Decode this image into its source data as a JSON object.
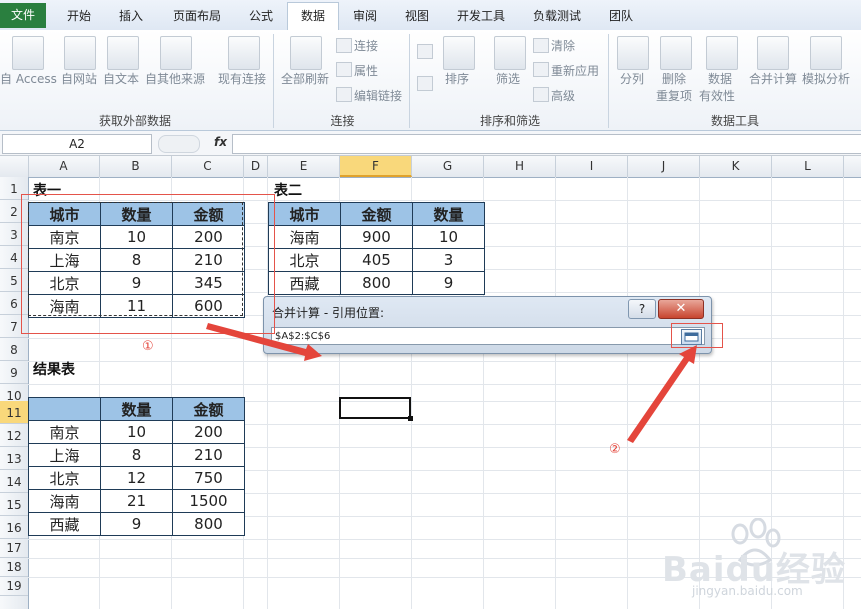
{
  "tabs": [
    "文件",
    "开始",
    "插入",
    "页面布局",
    "公式",
    "数据",
    "审阅",
    "视图",
    "开发工具",
    "负载测试",
    "团队"
  ],
  "ribbon": {
    "get_external": {
      "title": "获取外部数据",
      "buttons": [
        "自 Access",
        "自网站",
        "自文本",
        "自其他来源",
        "现有连接"
      ]
    },
    "connections": {
      "title": "连接",
      "refresh_all": "全部刷新",
      "small": [
        "连接",
        "属性",
        "编辑链接"
      ]
    },
    "sort_filter": {
      "title": "排序和筛选",
      "sort": "排序",
      "filter": "筛选",
      "small": [
        "清除",
        "重新应用",
        "高级"
      ]
    },
    "data_tools": {
      "title": "数据工具",
      "split": "分列",
      "remove_dup": [
        "删除",
        "重复项"
      ],
      "validation": [
        "数据",
        "有效性"
      ],
      "consolidate": "合并计算",
      "whatif": "模拟分析"
    }
  },
  "formula_bar": {
    "name_box": "A2",
    "fx": "fx",
    "content": ""
  },
  "columns": [
    "A",
    "B",
    "C",
    "D",
    "E",
    "F",
    "G",
    "H",
    "I",
    "J",
    "K",
    "L"
  ],
  "rows": [
    "1",
    "2",
    "3",
    "4",
    "5",
    "6",
    "7",
    "8",
    "9",
    "10",
    "11",
    "12",
    "13",
    "14",
    "15",
    "16",
    "17",
    "18",
    "19"
  ],
  "table1": {
    "title": "表一",
    "headers": [
      "城市",
      "数量",
      "金额"
    ],
    "rows": [
      [
        "南京",
        "10",
        "200"
      ],
      [
        "上海",
        "8",
        "210"
      ],
      [
        "北京",
        "9",
        "345"
      ],
      [
        "海南",
        "11",
        "600"
      ]
    ]
  },
  "table2": {
    "title": "表二",
    "headers": [
      "城市",
      "金额",
      "数量"
    ],
    "rows": [
      [
        "海南",
        "900",
        "10"
      ],
      [
        "北京",
        "405",
        "3"
      ],
      [
        "西藏",
        "800",
        "9"
      ]
    ]
  },
  "result": {
    "title": "结果表",
    "headers": [
      "",
      "数量",
      "金额"
    ],
    "rows": [
      [
        "南京",
        "10",
        "200"
      ],
      [
        "上海",
        "8",
        "210"
      ],
      [
        "北京",
        "12",
        "750"
      ],
      [
        "海南",
        "21",
        "1500"
      ],
      [
        "西藏",
        "9",
        "800"
      ]
    ]
  },
  "dialog": {
    "title": "合并计算 - 引用位置:",
    "help": "?",
    "close": "✕",
    "reference": "$A$2:$C$6"
  },
  "annotations": {
    "one": "①",
    "two": "②"
  },
  "watermark": {
    "brand": "Baidu经验",
    "url": "jingyan.baidu.com"
  },
  "colors": {
    "header_fill": "#9dc3e6",
    "annotation_red": "#e4453b",
    "file_tab": "#2a7f3f"
  }
}
